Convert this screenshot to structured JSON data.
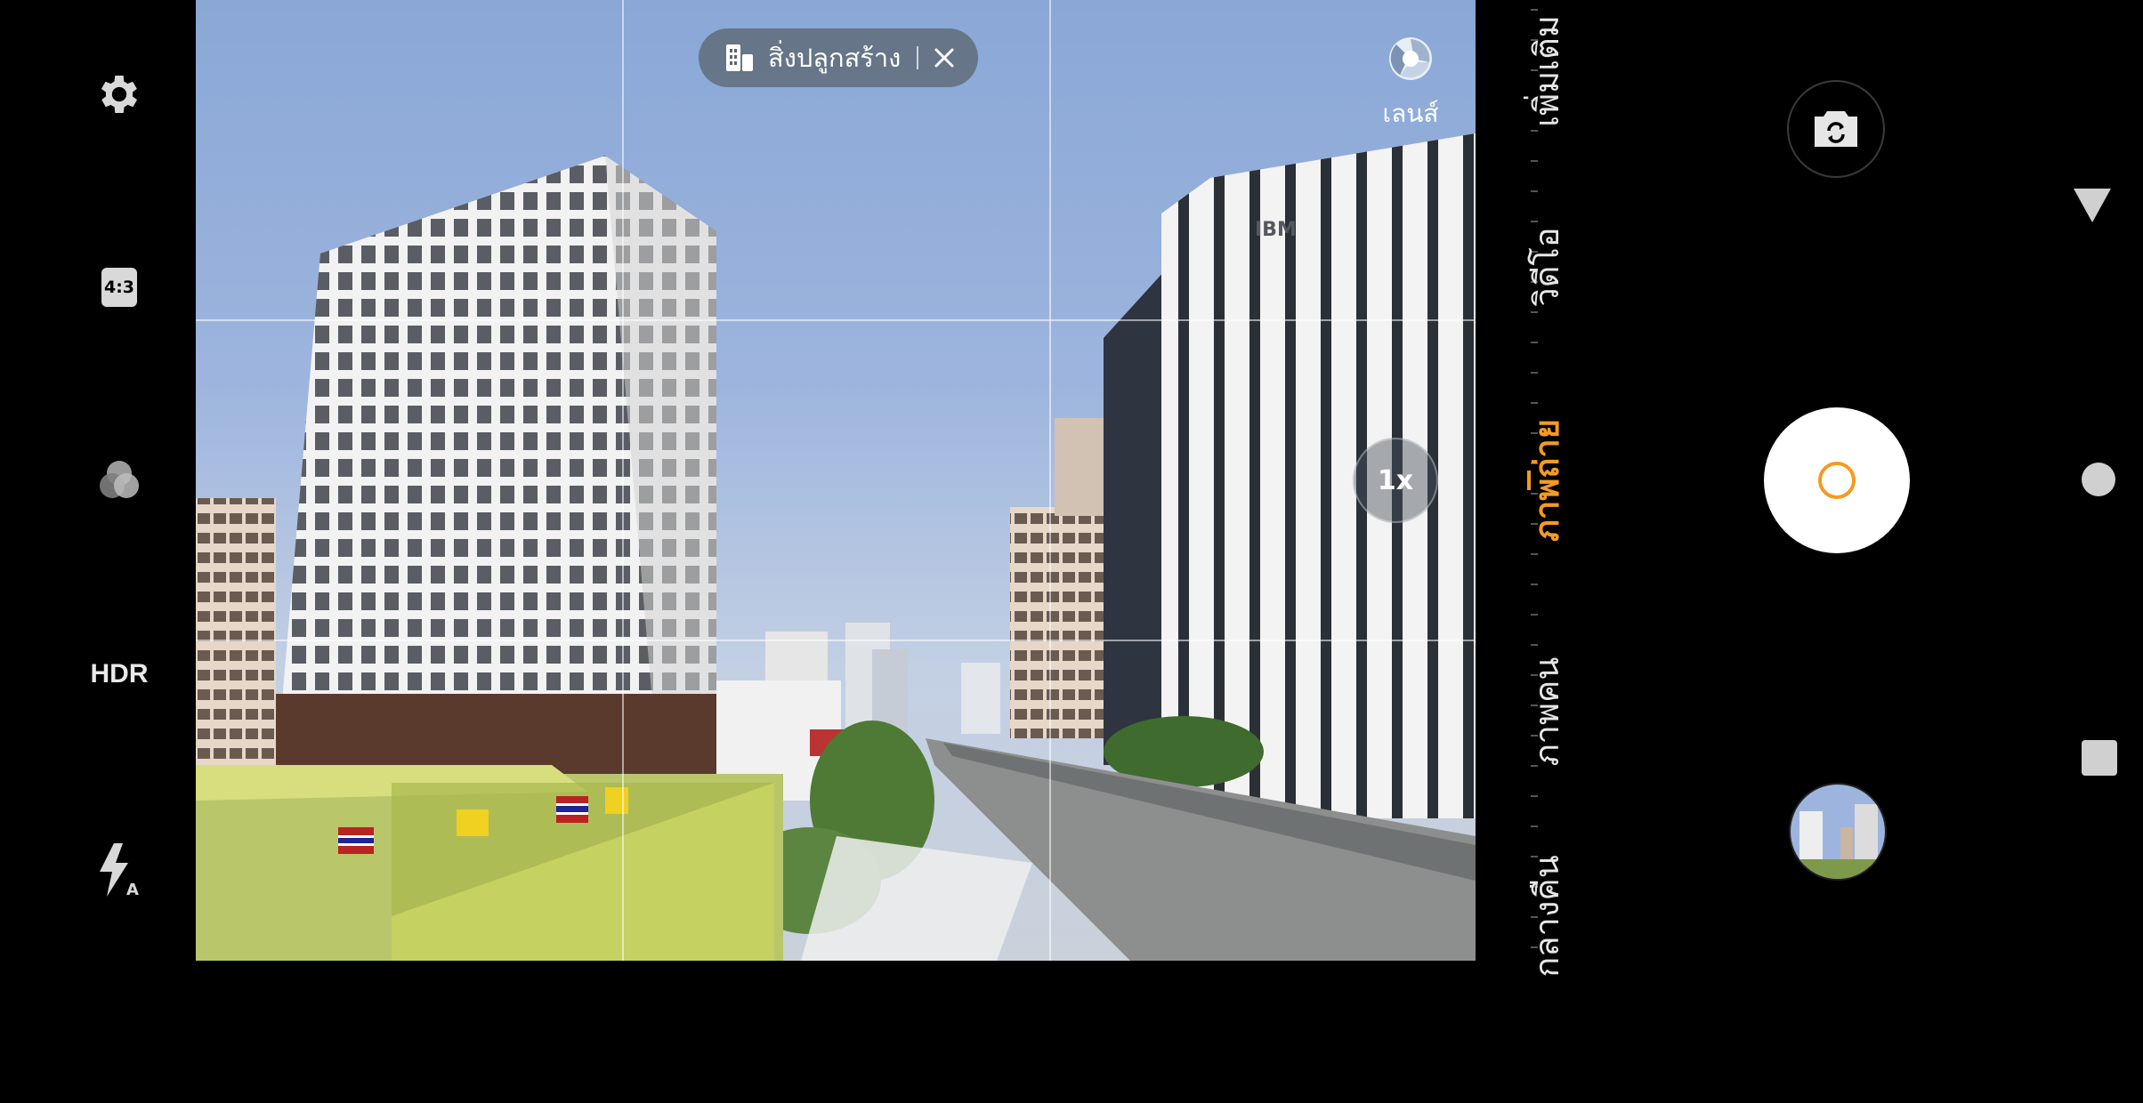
{
  "left_toolbar": {
    "settings_icon": "gear-icon",
    "aspect_ratio": "4:3",
    "filters_icon": "filters-icon",
    "hdr": "HDR",
    "flash_icon": "flash-auto-icon"
  },
  "viewfinder": {
    "scene_chip": {
      "icon": "buildings-icon",
      "label": "สิ่งปลูกสร้าง",
      "close_icon": "close-icon"
    },
    "lens": {
      "icon": "lens-icon",
      "label": "เลนส์"
    },
    "zoom": "1x"
  },
  "modes": {
    "items": [
      "เพิ่มเติม",
      "วิดีโอ",
      "ภาพถ่าย",
      "ภาพคน",
      "กลางคืน"
    ],
    "active": "ภาพถ่าย",
    "accent_color": "#f59a23"
  },
  "controls": {
    "switch_camera_icon": "camera-switch-icon",
    "shutter_icon": "shutter-button",
    "gallery_icon": "gallery-thumbnail"
  },
  "nav": {
    "back_icon": "back-triangle-icon",
    "home_icon": "home-circle-icon",
    "recents_icon": "recents-square-icon"
  }
}
